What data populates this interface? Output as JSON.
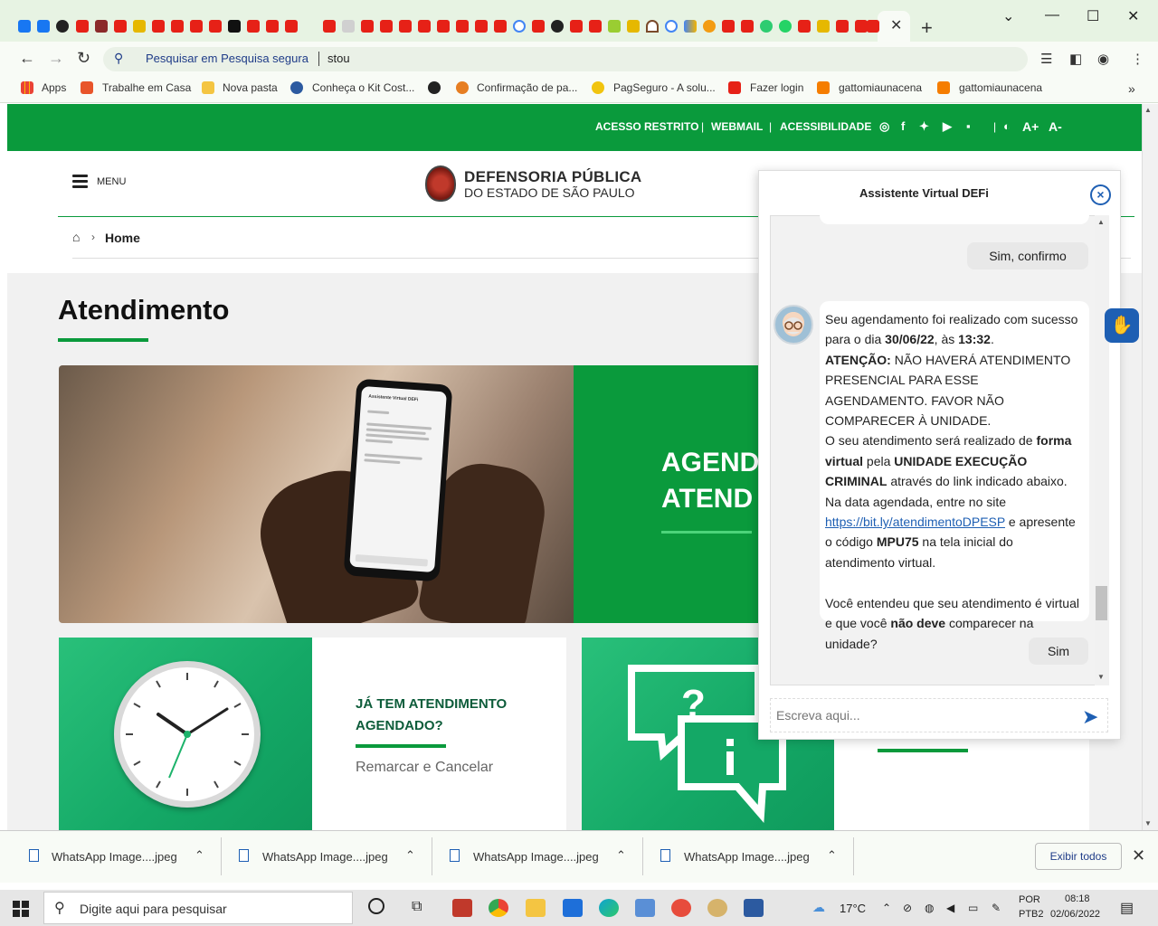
{
  "browser": {
    "omnibox_placeholder": "Pesquisar em Pesquisa segura",
    "omnibox_text": "stou",
    "bookmarks": [
      "Apps",
      "Trabalhe em Casa",
      "Nova pasta",
      "Conheça o Kit Cost...",
      "Confirmação de pa...",
      "PagSeguro - A solu...",
      "Fazer login",
      "gattomiaunacena",
      "gattomiaunacena"
    ]
  },
  "site": {
    "top_links": [
      "ACESSO RESTRITO",
      "WEBMAIL",
      "ACESSIBILIDADE"
    ],
    "font_controls": [
      "A+",
      "A-"
    ],
    "menu_label": "MENU",
    "logo_line1": "DEFENSORIA PÚBLICA",
    "logo_line2": "DO ESTADO DE SÃO PAULO",
    "breadcrumb_home": "Home",
    "page_title": "Atendimento",
    "hero_text": "AGEND\nATEND",
    "phone_title": "Assistente Virtual DEFi",
    "card1_title": "JÁ TEM ATENDIMENTO AGENDADO?",
    "card1_link": "Remarcar e Cancelar"
  },
  "chat": {
    "title": "Assistente Virtual DEFi",
    "close_symbol": "×",
    "user_reply_1": "Sim, confirmo",
    "bot_message": {
      "p1_a": "Seu agendamento foi realizado com sucesso para o dia ",
      "date": "30/06/22",
      "p1_b": ", às ",
      "time": "13:32",
      "p1_c": ".",
      "attention_label": "ATENÇÃO:",
      "attention_text": " NÃO HAVERÁ ATENDIMENTO PRESENCIAL PARA ESSE AGENDAMENTO. FAVOR NÃO COMPARECER À UNIDADE.",
      "p2_a": "O seu atendimento será realizado de ",
      "mode": "forma virtual",
      "p2_b": " pela ",
      "unit": "UNIDADE EXECUÇÃO CRIMINAL",
      "p2_c": " através do link indicado abaixo.",
      "p3_a": "Na data agendada, entre no site ",
      "link": "https://bit.ly/atendimentoDPESP",
      "p3_b": " e apresente o código ",
      "code": "MPU75",
      "p3_c": " na tela inicial do atendimento virtual.",
      "p4_a": "Você entendeu que seu atendimento é virtual e que você ",
      "p4_bold": "não deve",
      "p4_c": " comparecer na unidade?"
    },
    "user_reply_2": "Sim",
    "input_placeholder": "Escreva aqui..."
  },
  "downloads": {
    "items": [
      "WhatsApp Image....jpeg",
      "WhatsApp Image....jpeg",
      "WhatsApp Image....jpeg",
      "WhatsApp Image....jpeg"
    ],
    "show_all": "Exibir todos"
  },
  "taskbar": {
    "search_placeholder": "Digite aqui para pesquisar",
    "temperature": "17°C",
    "lang_line1": "POR",
    "lang_line2": "PTB2",
    "time": "08:18",
    "date": "02/06/2022"
  },
  "colors": {
    "brand_green": "#0a9a3c",
    "link_blue": "#1e5fb3"
  }
}
